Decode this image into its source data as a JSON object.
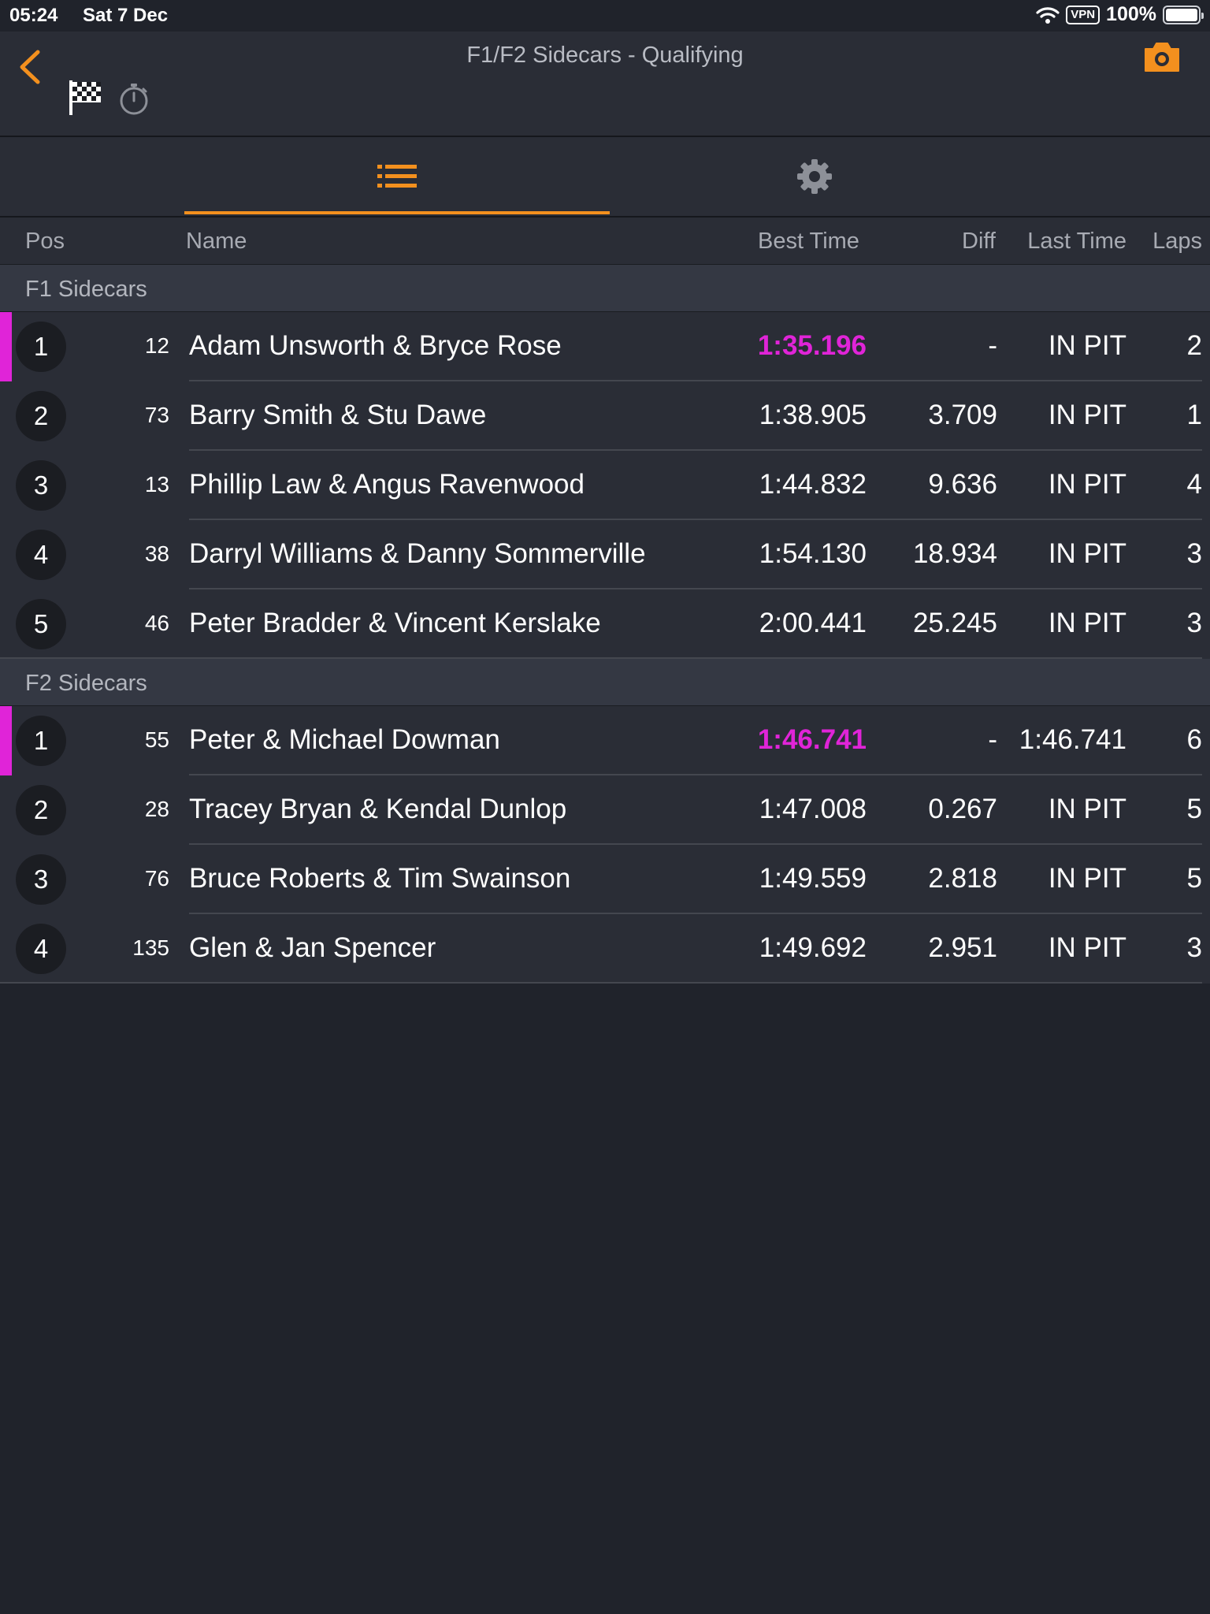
{
  "status_bar": {
    "time": "05:24",
    "date": "Sat 7 Dec",
    "vpn": "VPN",
    "battery": "100%",
    "battery_level_pct": 100
  },
  "nav": {
    "title": "F1/F2 Sidecars - Qualifying",
    "back_icon": "chevron-left-icon",
    "camera_icon": "camera-icon",
    "flag_icon": "checkered-flag-icon",
    "timer_icon": "stopwatch-icon"
  },
  "tabs": [
    {
      "icon": "list-icon",
      "selected": true
    },
    {
      "icon": "gear-icon",
      "selected": false
    }
  ],
  "columns": {
    "pos": "Pos",
    "name": "Name",
    "best_time": "Best Time",
    "diff": "Diff",
    "last_time": "Last Time",
    "laps": "Laps"
  },
  "colors": {
    "accent": "#f3901e",
    "fastest": "#e024d8",
    "background": "#20232b",
    "row": "#2a2d36",
    "section": "#343843"
  },
  "classes": [
    {
      "name": "F1 Sidecars",
      "rows": [
        {
          "pos": "1",
          "number": "12",
          "name": "Adam Unsworth & Bryce Rose",
          "best": "1:35.196",
          "diff": "-",
          "last": "IN PIT",
          "laps": "2",
          "fastest": true
        },
        {
          "pos": "2",
          "number": "73",
          "name": "Barry Smith & Stu Dawe",
          "best": "1:38.905",
          "diff": "3.709",
          "last": "IN PIT",
          "laps": "1",
          "fastest": false
        },
        {
          "pos": "3",
          "number": "13",
          "name": "Phillip Law & Angus Ravenwood",
          "best": "1:44.832",
          "diff": "9.636",
          "last": "IN PIT",
          "laps": "4",
          "fastest": false
        },
        {
          "pos": "4",
          "number": "38",
          "name": "Darryl Williams & Danny Sommerville",
          "best": "1:54.130",
          "diff": "18.934",
          "last": "IN PIT",
          "laps": "3",
          "fastest": false
        },
        {
          "pos": "5",
          "number": "46",
          "name": "Peter Bradder & Vincent Kerslake",
          "best": "2:00.441",
          "diff": "25.245",
          "last": "IN PIT",
          "laps": "3",
          "fastest": false
        }
      ]
    },
    {
      "name": "F2 Sidecars",
      "rows": [
        {
          "pos": "1",
          "number": "55",
          "name": "Peter & Michael Dowman",
          "best": "1:46.741",
          "diff": "-",
          "last": "1:46.741",
          "laps": "6",
          "fastest": true
        },
        {
          "pos": "2",
          "number": "28",
          "name": "Tracey Bryan & Kendal Dunlop",
          "best": "1:47.008",
          "diff": "0.267",
          "last": "IN PIT",
          "laps": "5",
          "fastest": false
        },
        {
          "pos": "3",
          "number": "76",
          "name": "Bruce Roberts & Tim Swainson",
          "best": "1:49.559",
          "diff": "2.818",
          "last": "IN PIT",
          "laps": "5",
          "fastest": false
        },
        {
          "pos": "4",
          "number": "135",
          "name": "Glen & Jan Spencer",
          "best": "1:49.692",
          "diff": "2.951",
          "last": "IN PIT",
          "laps": "3",
          "fastest": false
        }
      ]
    }
  ]
}
